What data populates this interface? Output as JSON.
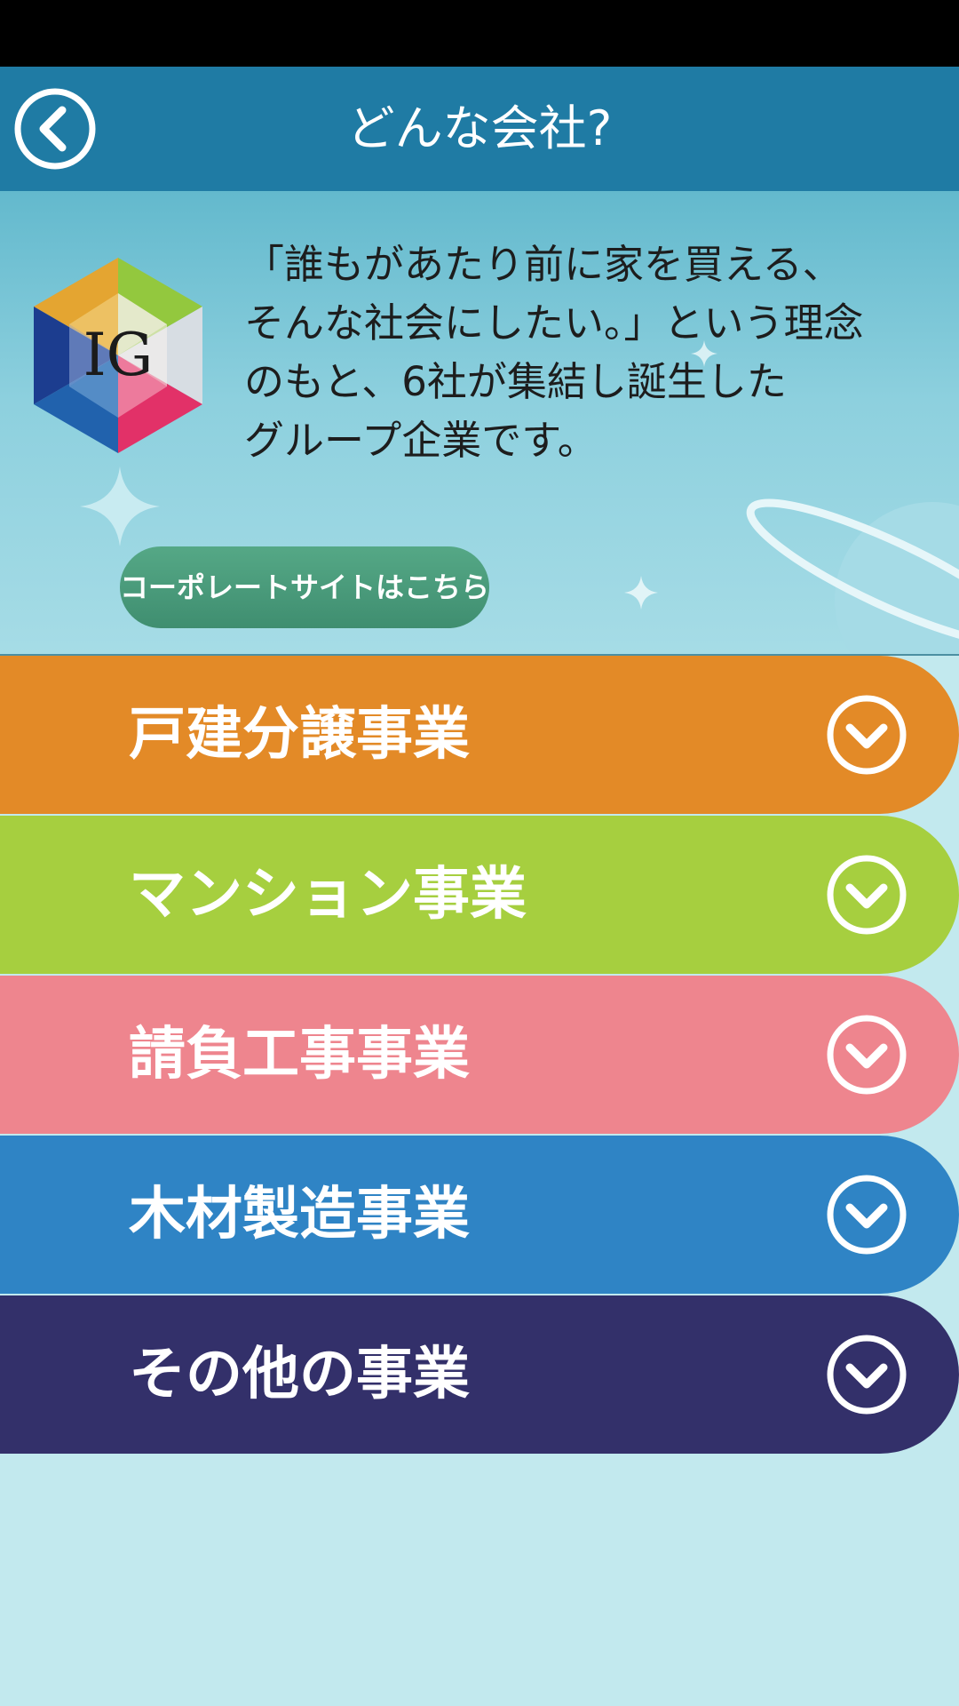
{
  "header": {
    "title": "どんな会社?",
    "back_icon": "chevron-left-circle-icon"
  },
  "intro": {
    "logo_text": "IG",
    "description": "「誰もがあたり前に家を買える、\nそんな社会にしたい。」という理念\nのもと、6社が集結し誕生した\nグループ企業です。",
    "corporate_button_label": "コーポレートサイトはこちら"
  },
  "businesses": [
    {
      "label": "戸建分譲事業",
      "color": "#e38a27"
    },
    {
      "label": "マンション事業",
      "color": "#a6cf3f"
    },
    {
      "label": "請負工事事業",
      "color": "#ee858e"
    },
    {
      "label": "木材製造事業",
      "color": "#2f84c5"
    },
    {
      "label": "その他の事業",
      "color": "#33306a"
    }
  ],
  "colors": {
    "header": "#1f7ba4",
    "background": "#c2e9ee",
    "corporate_button": "#4a9a7a"
  }
}
